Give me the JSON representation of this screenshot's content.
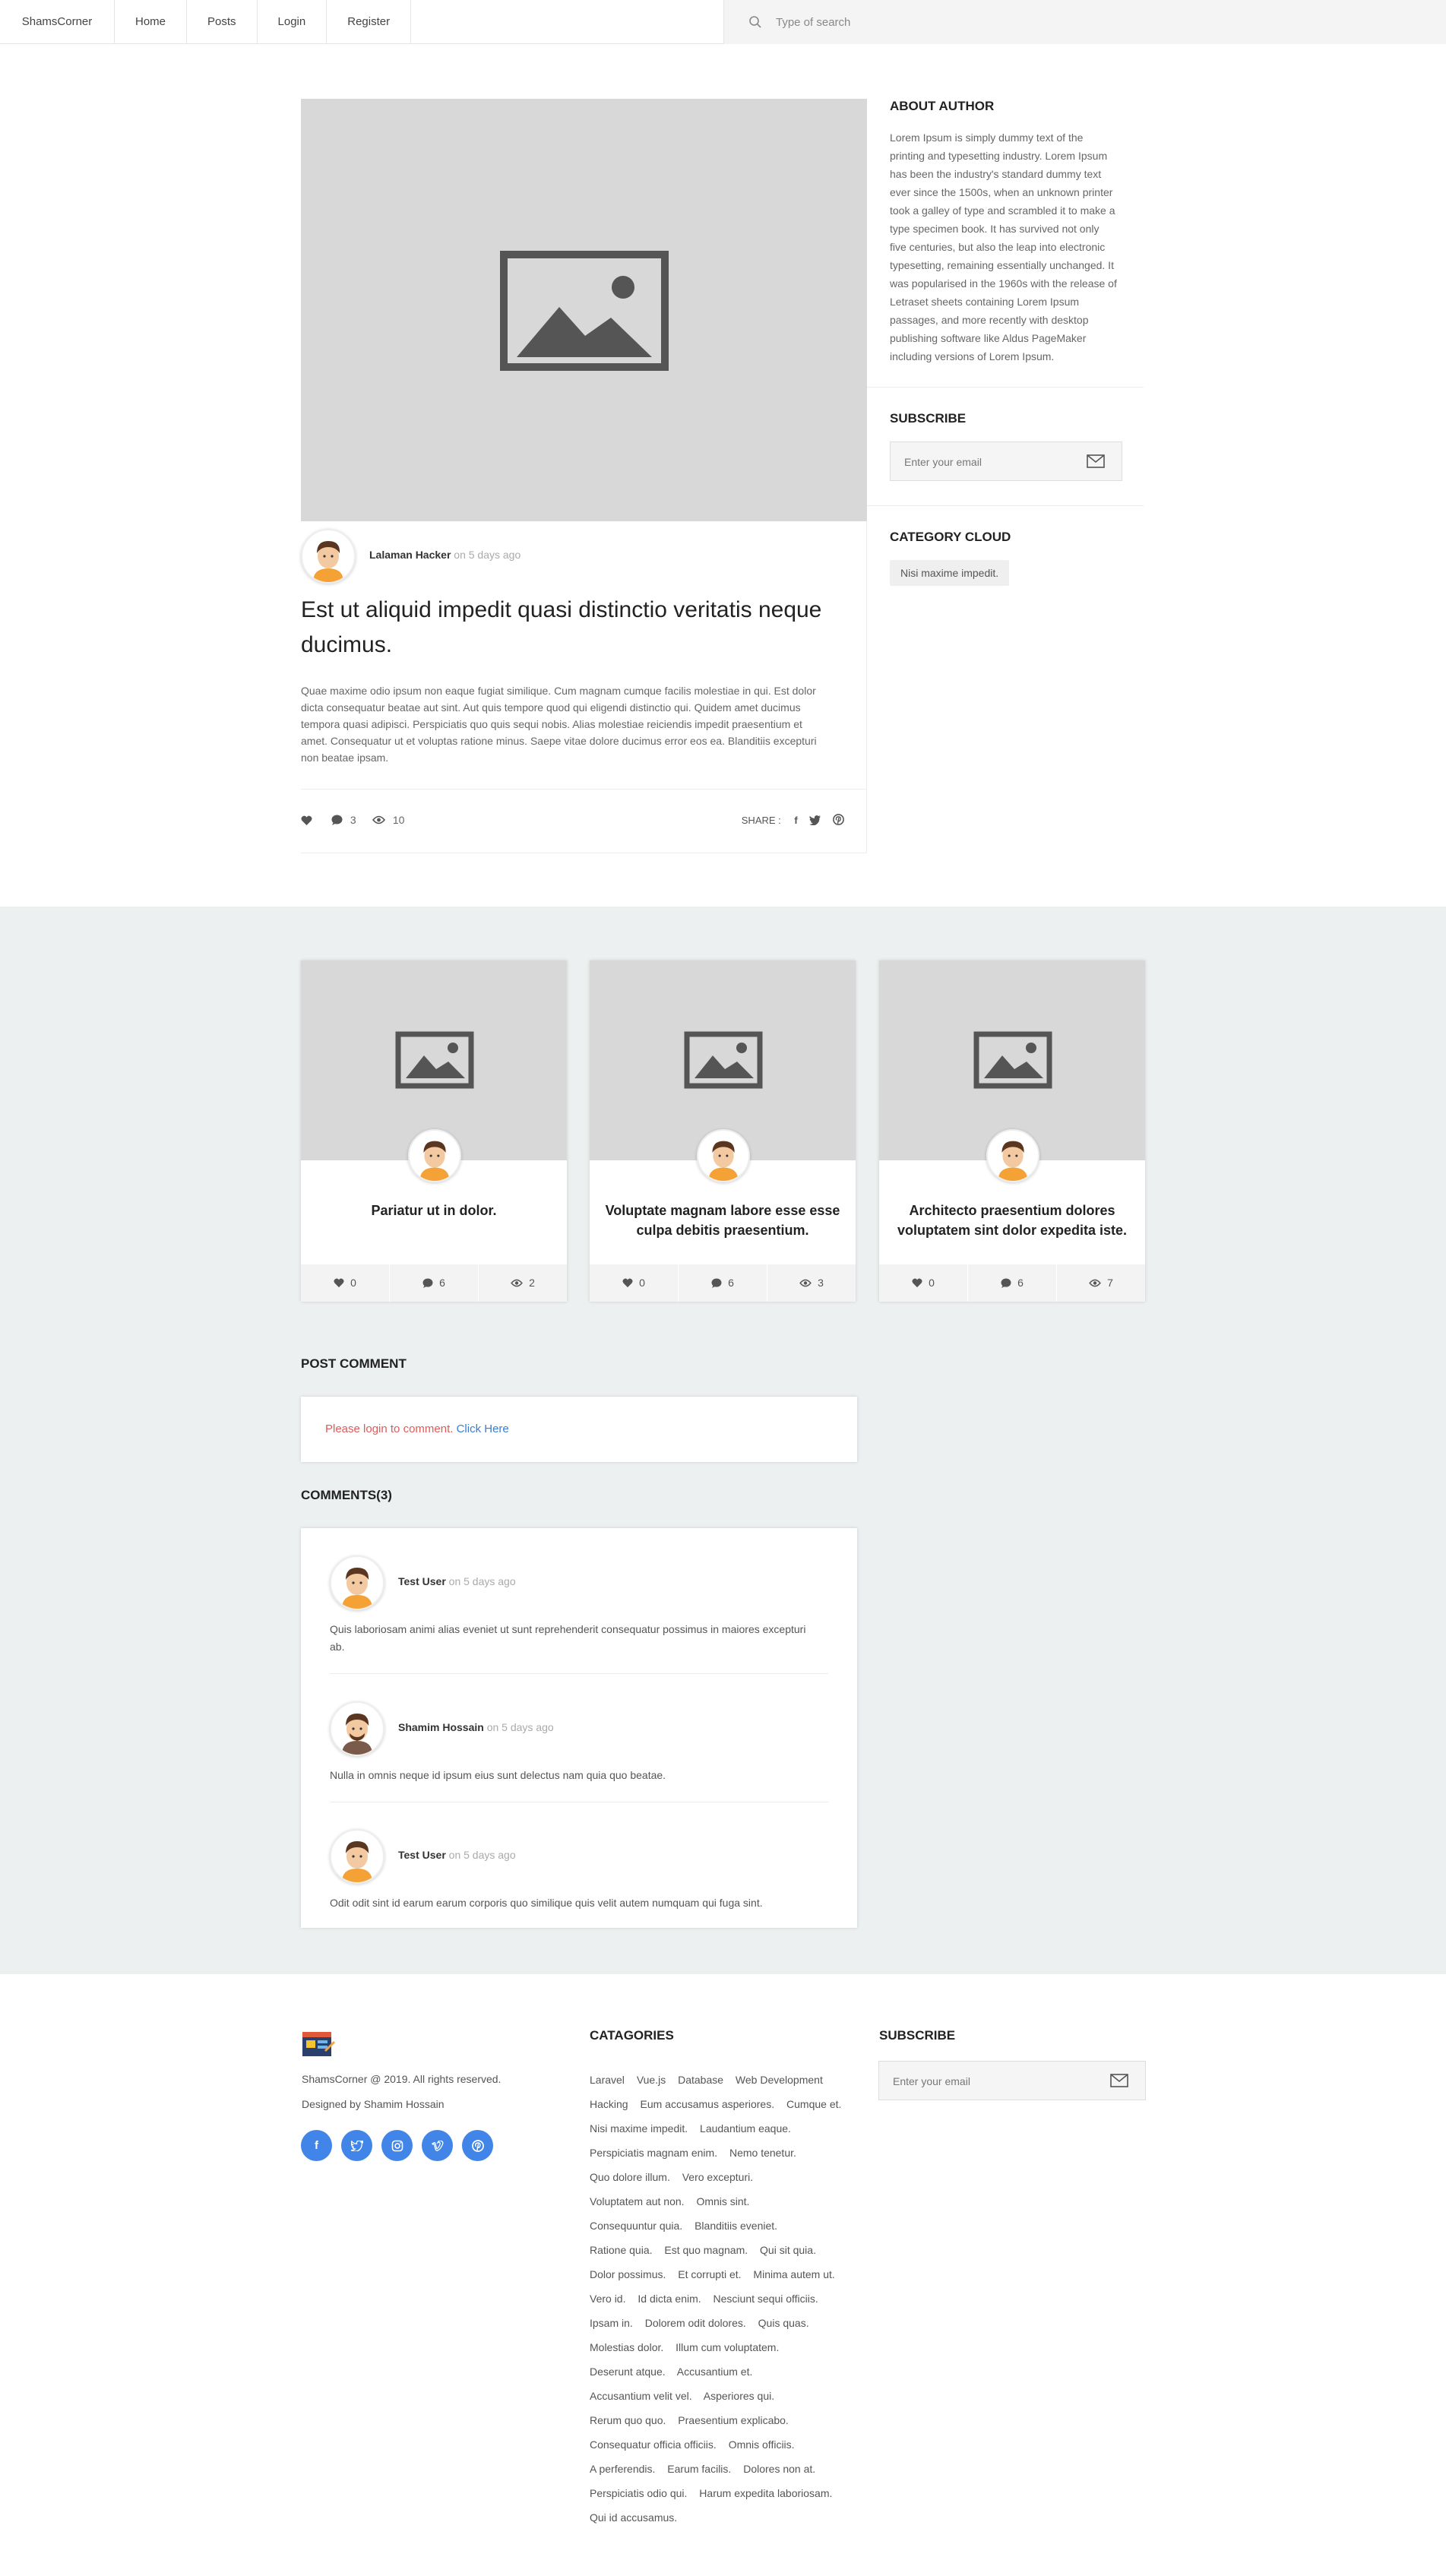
{
  "header": {
    "brand": "ShamsCorner",
    "nav": [
      "Home",
      "Posts",
      "Login",
      "Register"
    ],
    "search_placeholder": "Type of search"
  },
  "post": {
    "author": "Lalaman Hacker",
    "time": "on 5 days ago",
    "title": "Est ut aliquid impedit quasi distinctio veritatis neque ducimus.",
    "body": "Quae maxime odio ipsum non eaque fugiat similique. Cum magnam cumque facilis molestiae in qui. Est dolor dicta consequatur beatae aut sint. Aut quis tempore quod qui eligendi distinctio qui. Quidem amet ducimus tempora quasi adipisci. Perspiciatis quo quis sequi nobis. Alias molestiae reiciendis impedit praesentium et amet. Consequatur ut et voluptas ratione minus. Saepe vitae dolore ducimus error eos ea. Blanditiis excepturi non beatae ipsam.",
    "comments_count": "3",
    "views_count": "10",
    "share_label": "SHARE :"
  },
  "sidebar": {
    "about_title": "ABOUT AUTHOR",
    "about_text": "Lorem Ipsum is simply dummy text of the printing and typesetting industry. Lorem Ipsum has been the industry's standard dummy text ever since the 1500s, when an unknown printer took a galley of type and scrambled it to make a type specimen book. It has survived not only five centuries, but also the leap into electronic typesetting, remaining essentially unchanged. It was popularised in the 1960s with the release of Letraset sheets containing Lorem Ipsum passages, and more recently with desktop publishing software like Aldus PageMaker including versions of Lorem Ipsum.",
    "subscribe_title": "SUBSCRIBE",
    "email_placeholder": "Enter your email",
    "category_title": "CATEGORY CLOUD",
    "category_tag": "Nisi maxime impedit."
  },
  "related": [
    {
      "title": "Pariatur ut in dolor.",
      "likes": "0",
      "comments": "6",
      "views": "2"
    },
    {
      "title": "Voluptate magnam labore esse esse culpa debitis praesentium.",
      "likes": "0",
      "comments": "6",
      "views": "3"
    },
    {
      "title": "Architecto praesentium dolores voluptatem sint dolor expedita iste.",
      "likes": "0",
      "comments": "6",
      "views": "7"
    }
  ],
  "post_comment": {
    "title": "POST COMMENT",
    "login_text": "Please login to comment.",
    "login_link": "Click Here"
  },
  "comments": {
    "title": "COMMENTS(3)",
    "items": [
      {
        "name": "Test User",
        "time": "on 5 days ago",
        "text": "Quis laboriosam animi alias eveniet ut sunt reprehenderit consequatur possimus in maiores excepturi ab."
      },
      {
        "name": "Shamim Hossain",
        "time": "on 5 days ago",
        "text": "Nulla in omnis neque id ipsum eius sunt delectus nam quia quo beatae."
      },
      {
        "name": "Test User",
        "time": "on 5 days ago",
        "text": "Odit odit sint id earum earum corporis quo similique quis velit autem numquam qui fuga sint."
      }
    ]
  },
  "footer": {
    "copyright": "ShamsCorner @ 2019. All rights reserved.",
    "designed": "Designed by Shamim Hossain",
    "categories_title": "CATAGORIES",
    "categories": [
      "Laravel",
      "Vue.js",
      "Database",
      "Web Development",
      "Hacking",
      "Eum accusamus asperiores.",
      "Cumque et.",
      "Nisi maxime impedit.",
      "Laudantium eaque.",
      "Perspiciatis magnam enim.",
      "Nemo tenetur.",
      "Quo dolore illum.",
      "Vero excepturi.",
      "Voluptatem aut non.",
      "Omnis sint.",
      "Consequuntur quia.",
      "Blanditiis eveniet.",
      "Ratione quia.",
      "Est quo magnam.",
      "Qui sit quia.",
      "Dolor possimus.",
      "Et corrupti et.",
      "Minima autem ut.",
      "Vero id.",
      "Id dicta enim.",
      "Nesciunt sequi officiis.",
      "Ipsam in.",
      "Dolorem odit dolores.",
      "Quis quas.",
      "Molestias dolor.",
      "Illum cum voluptatem.",
      "Deserunt atque.",
      "Accusantium et.",
      "Accusantium velit vel.",
      "Asperiores qui.",
      "Rerum quo quo.",
      "Praesentium explicabo.",
      "Consequatur officia officiis.",
      "Omnis officiis.",
      "A perferendis.",
      "Earum facilis.",
      "Dolores non at.",
      "Perspiciatis odio qui.",
      "Harum expedita laboriosam.",
      "Qui id accusamus."
    ],
    "subscribe_title": "SUBSCRIBE",
    "email_placeholder": "Enter your email",
    "socials": [
      "facebook-icon",
      "twitter-icon",
      "instagram-icon",
      "vimeo-icon",
      "pinterest-icon"
    ]
  }
}
